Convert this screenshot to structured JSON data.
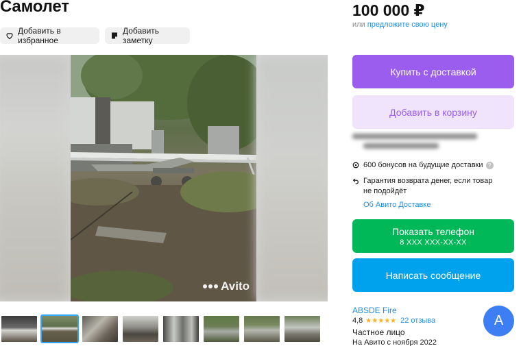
{
  "listing": {
    "title": "Самолет",
    "actions": {
      "favorite_label": "Добавить в избранное",
      "note_label": "Добавить заметку"
    }
  },
  "gallery": {
    "watermark": "Avito",
    "thumbnail_count": 8,
    "active_thumbnail": 2
  },
  "pricing": {
    "price": "100 000 ₽",
    "suggest_prefix": "или",
    "suggest_link": "предложите свою цену"
  },
  "buttons": {
    "buy_label": "Купить с доставкой",
    "cart_label": "Добавить в корзину",
    "phone_label": "Показать телефон",
    "phone_number": "8 XXX XXX-XX-XX",
    "message_label": "Написать сообщение"
  },
  "delivery": {
    "bonuses_text": "600 бонусов на будущие доставки",
    "help_symbol": "?",
    "guarantee_text": "Гарантия возврата денег, если товар не подойдёт",
    "about_link": "Об Авито Доставке"
  },
  "seller": {
    "name": "ABSDE Fire",
    "rating": "4,8",
    "stars": "★★★★★",
    "reviews": "22 отзыва",
    "type": "Частное лицо",
    "since": "На Авито с ноября 2022",
    "avatar_letter": "А"
  },
  "colors": {
    "buy": "#9a5ded",
    "cart_bg": "#efe4fc",
    "phone": "#00b858",
    "message": "#00a2ee",
    "link": "#1f8ee8",
    "avatar": "#3d7ff2"
  }
}
